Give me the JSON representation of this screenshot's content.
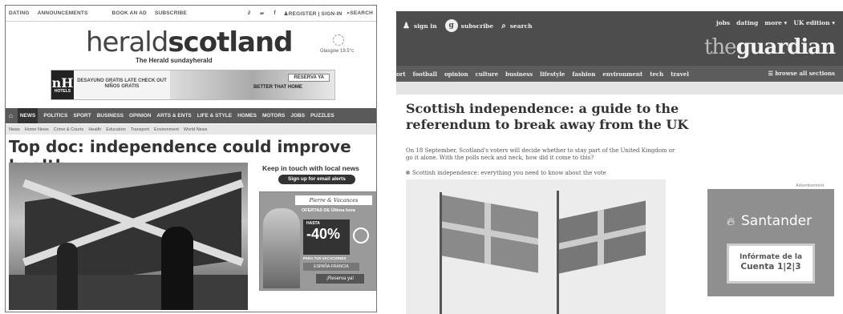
{
  "herald": {
    "top_items": [
      "DATING",
      "ANNOUNCEMENTS",
      "BOOK AN AD",
      "SUBSCRIBE"
    ],
    "register": "REGISTER | SIGN-IN",
    "search": "SEARCH",
    "logo_light": "herald",
    "logo_bold": "scotland",
    "logo_sub": "The Herald   sundayherald",
    "weather": "Glasgow 19.5°c",
    "ad": {
      "brand": "nH",
      "brand_sub": "HOTELS",
      "promo": "DESAYUNO GRATIS LATE CHECK OUT NIÑOS GRATIS",
      "reserva": "RESERVA YA",
      "better": "BETTER THAT HOME"
    },
    "nav": [
      "NEWS",
      "POLITICS",
      "SPORT",
      "BUSINESS",
      "OPINION",
      "ARTS & ENTS",
      "LIFE & STYLE",
      "HOMES",
      "MOTORS",
      "JOBS",
      "PUZZLES"
    ],
    "subnav": [
      "News",
      "Home News",
      "Crime & Courts",
      "Health",
      "Education",
      "Transport",
      "Environment",
      "World News"
    ],
    "headline": "Top doc: independence could improve health",
    "keep_in_touch": "Keep in touch with local news",
    "signup": "Sign up for email alerts",
    "ad2": {
      "brand": "Pierre & Vacances",
      "ofertas": "OFERTAS DE Última hora",
      "hasta": "HASTA",
      "pct": "-40%",
      "vac": "PARA TUS VACACIONES",
      "esp": "ESPAÑA-FRANCIA",
      "reserva": "¡Reserva ya!"
    }
  },
  "guardian": {
    "sign_in": "sign in",
    "subscribe": "subscribe",
    "search": "search",
    "top_right": [
      "jobs",
      "dating",
      "more ▾",
      "UK edition ▾"
    ],
    "logo_the": "the",
    "logo_name": "guardian",
    "nav": [
      "ort",
      "football",
      "opinion",
      "culture",
      "business",
      "lifestyle",
      "fashion",
      "environment",
      "tech",
      "travel"
    ],
    "browse": "☰ browse all sections",
    "title": "Scottish independence: a guide to the referendum to break away from the UK",
    "standfirst": "On 18 September, Scotland's voters will decide whether to stay part of the United Kingdom or go it alone. With the polls neck and neck, how did it come to this?",
    "link": "Scottish independence: everything you need to know about the vote",
    "ad_label": "Advertisement",
    "ad": {
      "name": "Santander",
      "line1": "Infórmate de la",
      "line2": "Cuenta 1|2|3"
    }
  }
}
